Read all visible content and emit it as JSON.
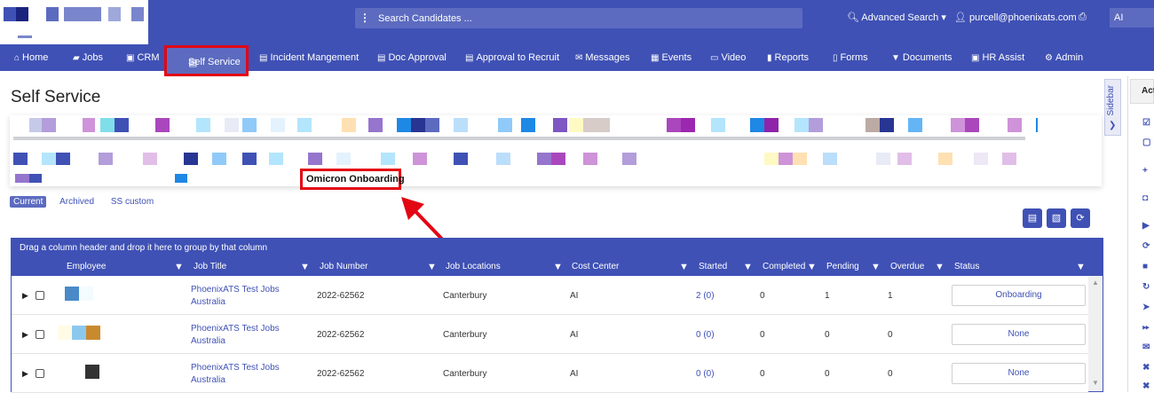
{
  "topbar": {
    "search_placeholder": "Search Candidates ...",
    "advanced_search": "Advanced Search",
    "user_email": "purcell@phoenixats.com",
    "region": "AI"
  },
  "nav": {
    "items": [
      {
        "label": "Home",
        "icon": "home-icon"
      },
      {
        "label": "Jobs",
        "icon": "folder-icon"
      },
      {
        "label": "CRM",
        "icon": "briefcase-icon"
      },
      {
        "label": "Self Service",
        "icon": "list-icon"
      },
      {
        "label": "Incident Mangement",
        "icon": "list-icon"
      },
      {
        "label": "Doc Approval",
        "icon": "list-icon"
      },
      {
        "label": "Approval to Recruit",
        "icon": "list-icon"
      },
      {
        "label": "Messages",
        "icon": "envelope-icon"
      },
      {
        "label": "Events",
        "icon": "calendar-icon"
      },
      {
        "label": "Video",
        "icon": "video-icon"
      },
      {
        "label": "Reports",
        "icon": "report-icon"
      },
      {
        "label": "Forms",
        "icon": "file-icon"
      },
      {
        "label": "Documents",
        "icon": "filter-icon"
      },
      {
        "label": "HR Assist",
        "icon": "briefcase-icon"
      },
      {
        "label": "Admin",
        "icon": "gear-icon"
      }
    ]
  },
  "page": {
    "title": "Self Service",
    "sidebar_label": "Sidebar",
    "right_panel_head": "Acti",
    "active_tab": "Omicron Onboarding",
    "subtabs": [
      "Current",
      "Archived",
      "SS custom"
    ]
  },
  "grid": {
    "group_hint": "Drag a column header and drop it here to group by that column",
    "columns": [
      "Employee",
      "Job Title",
      "Job Number",
      "Job Locations",
      "Cost Center",
      "Started",
      "Completed",
      "Pending",
      "Overdue",
      "Status"
    ],
    "rows": [
      {
        "job_title_1": "PhoenixATS Test Jobs",
        "job_title_2": "Australia",
        "job_number": "2022-62562",
        "location": "Canterbury",
        "cost_center": "AI",
        "started": "2 (0)",
        "completed": "0",
        "pending": "1",
        "overdue": "1",
        "status": "Onboarding"
      },
      {
        "job_title_1": "PhoenixATS Test Jobs",
        "job_title_2": "Australia",
        "job_number": "2022-62562",
        "location": "Canterbury",
        "cost_center": "AI",
        "started": "0 (0)",
        "completed": "0",
        "pending": "0",
        "overdue": "0",
        "status": "None"
      },
      {
        "job_title_1": "PhoenixATS Test Jobs",
        "job_title_2": "Australia",
        "job_number": "2022-62562",
        "location": "Canterbury",
        "cost_center": "AI",
        "started": "0 (0)",
        "completed": "0",
        "pending": "0",
        "overdue": "0",
        "status": "None"
      }
    ]
  },
  "colors": {
    "brand": "#3f51b5",
    "highlight": "#e30613"
  }
}
